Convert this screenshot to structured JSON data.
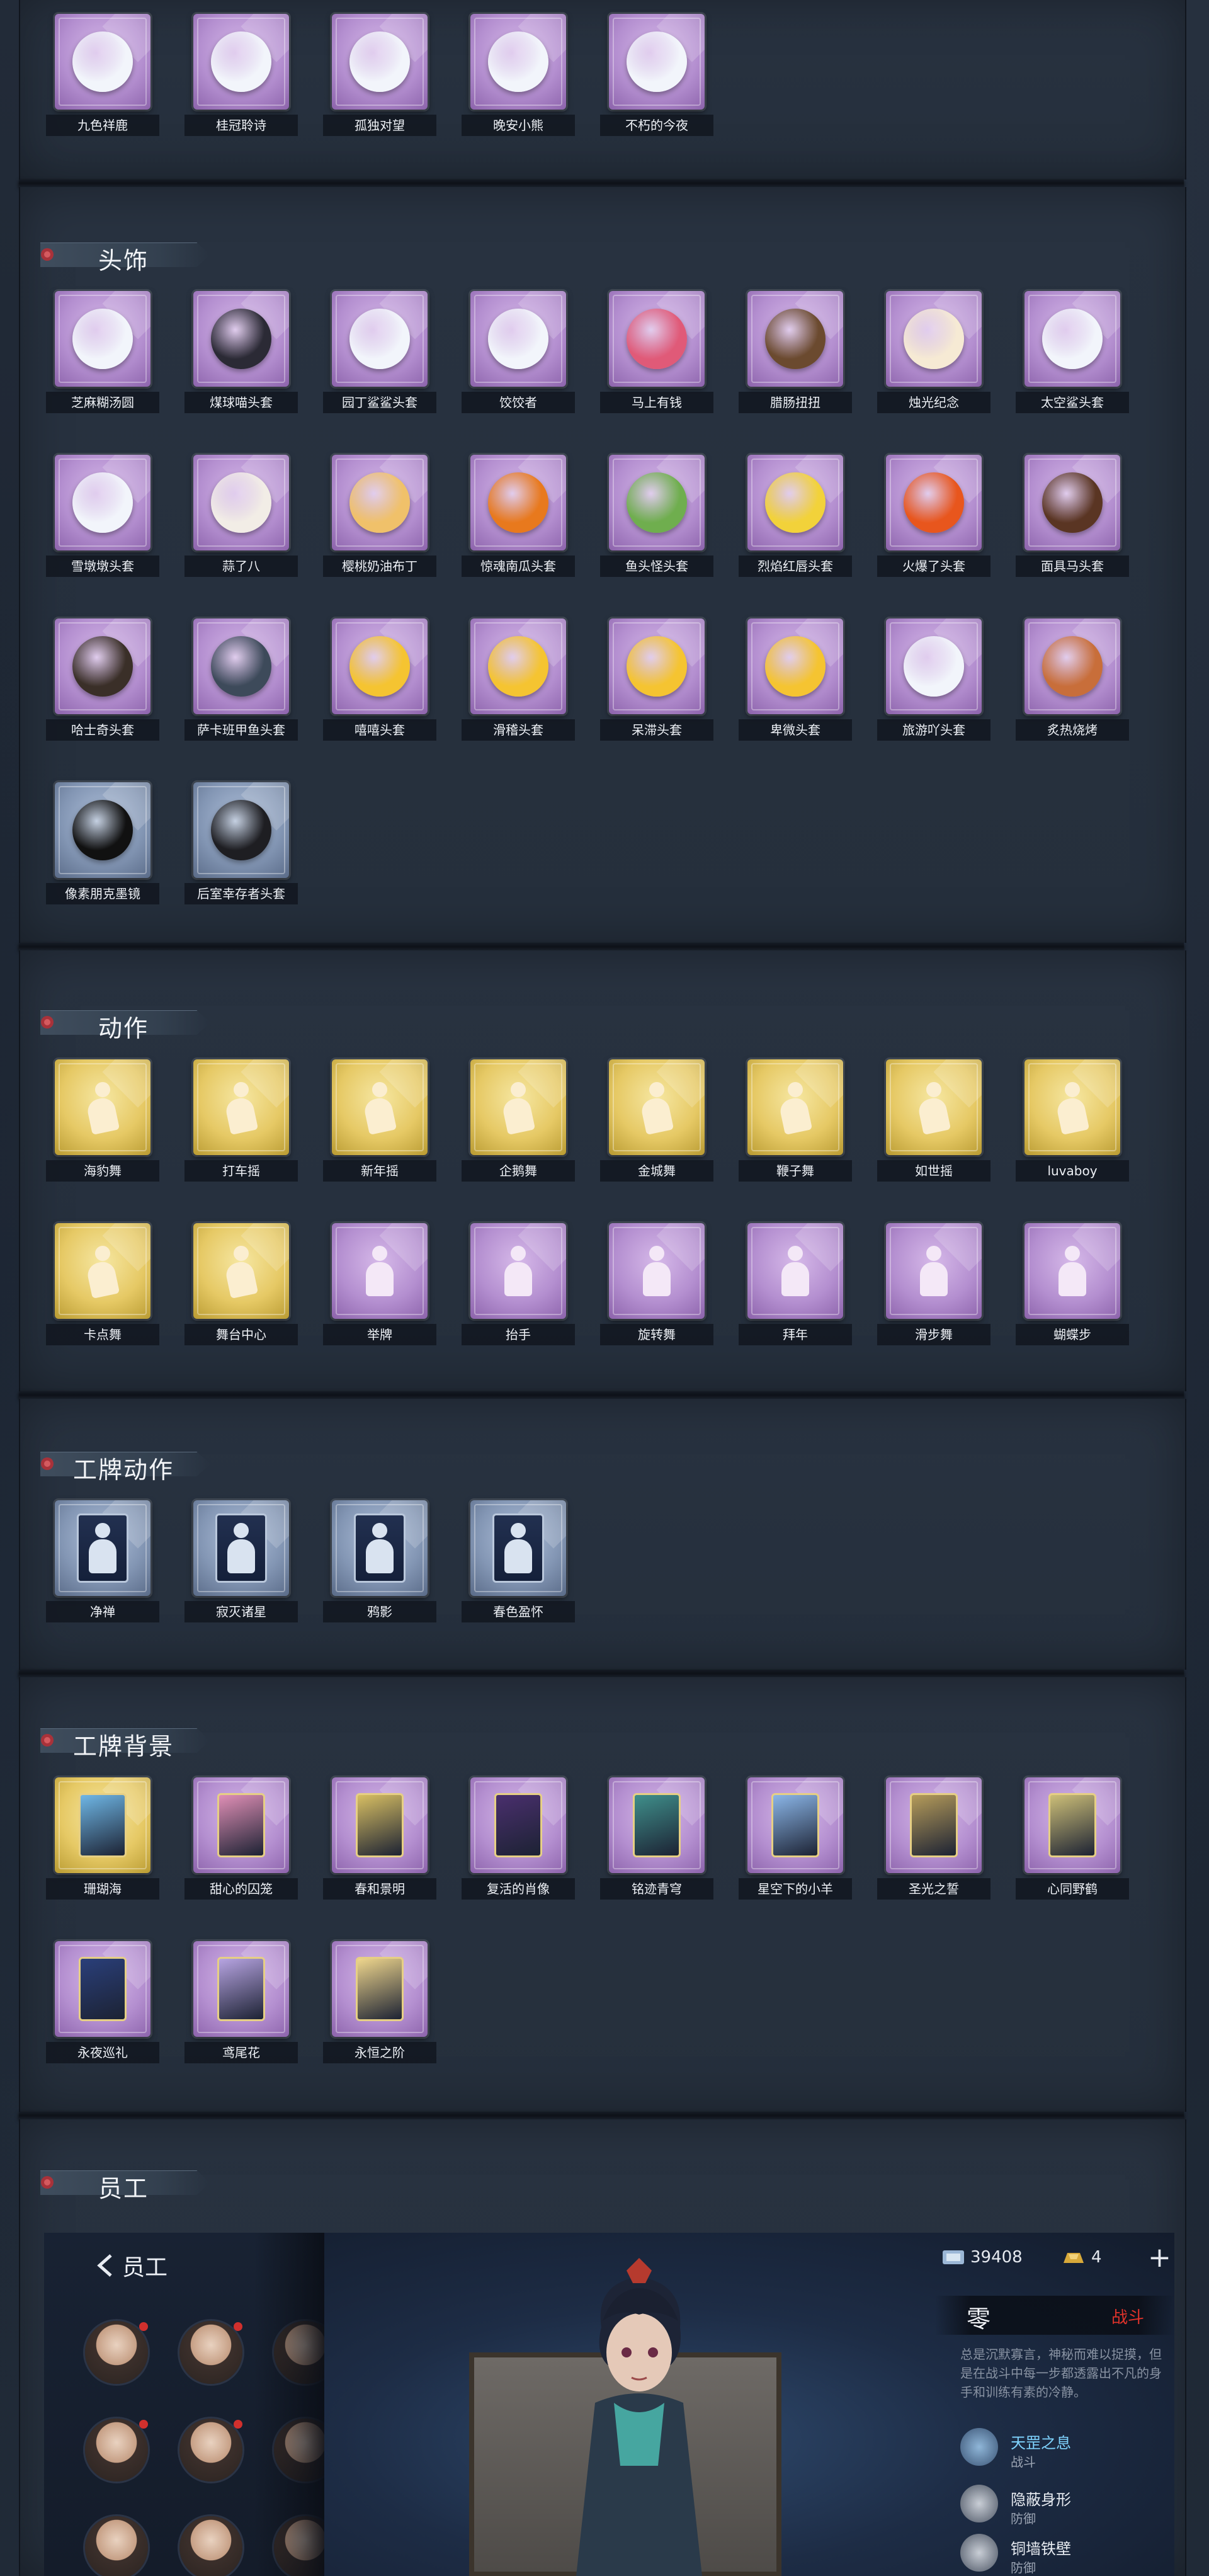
{
  "sections": {
    "top_row": {
      "items": [
        {
          "label": "九色祥鹿",
          "color": "purple",
          "icon": "deer-charm-icon"
        },
        {
          "label": "桂冠聆诗",
          "color": "purple",
          "icon": "laurel-charm-icon"
        },
        {
          "label": "孤独对望",
          "color": "purple",
          "icon": "doll-charm-icon"
        },
        {
          "label": "晚安小熊",
          "color": "purple",
          "icon": "bear-charm-icon"
        },
        {
          "label": "不朽的今夜",
          "color": "purple",
          "icon": "pink-charm-icon"
        }
      ]
    },
    "headwear": {
      "title": "头饰",
      "items": [
        {
          "label": "芝麻糊汤圆",
          "color": "purple",
          "icon": "dumpling-head-icon"
        },
        {
          "label": "煤球喵头套",
          "color": "purple",
          "icon": "black-cat-head-icon"
        },
        {
          "label": "园丁鲨鲨头套",
          "color": "purple",
          "icon": "shark-head-icon"
        },
        {
          "label": "饺饺者",
          "color": "purple",
          "icon": "cloud-head-icon"
        },
        {
          "label": "马上有钱",
          "color": "purple",
          "icon": "horse-head-icon"
        },
        {
          "label": "腊肠扭扭",
          "color": "purple",
          "icon": "dog-head-icon"
        },
        {
          "label": "烛光纪念",
          "color": "purple",
          "icon": "candle-head-icon"
        },
        {
          "label": "太空鲨头套",
          "color": "purple",
          "icon": "space-shark-head-icon"
        },
        {
          "label": "雪墩墩头套",
          "color": "purple",
          "icon": "snowman-head-icon"
        },
        {
          "label": "蒜了八",
          "color": "purple",
          "icon": "garlic-head-icon"
        },
        {
          "label": "樱桃奶油布丁",
          "color": "purple",
          "icon": "pudding-head-icon"
        },
        {
          "label": "惊魂南瓜头套",
          "color": "purple",
          "icon": "pumpkin-head-icon"
        },
        {
          "label": "鱼头怪头套",
          "color": "purple",
          "icon": "fish-monster-head-icon"
        },
        {
          "label": "烈焰红唇头套",
          "color": "purple",
          "icon": "yellow-creature-head-icon"
        },
        {
          "label": "火爆了头套",
          "color": "purple",
          "icon": "fireball-head-icon"
        },
        {
          "label": "面具马头套",
          "color": "purple",
          "icon": "brown-horse-head-icon"
        },
        {
          "label": "哈士奇头套",
          "color": "purple",
          "icon": "husky-head-icon"
        },
        {
          "label": "萨卡班甲鱼头套",
          "color": "purple",
          "icon": "fish-head-icon"
        },
        {
          "label": "嘻嘻头套",
          "color": "purple",
          "icon": "grin-emoji-head-icon"
        },
        {
          "label": "滑稽头套",
          "color": "purple",
          "icon": "smirk-emoji-head-icon"
        },
        {
          "label": "呆滞头套",
          "color": "purple",
          "icon": "dazed-emoji-head-icon"
        },
        {
          "label": "卑微头套",
          "color": "purple",
          "icon": "humble-emoji-head-icon"
        },
        {
          "label": "旅游吖头套",
          "color": "purple",
          "icon": "tourist-head-icon"
        },
        {
          "label": "炙热烧烤",
          "color": "purple",
          "icon": "barbecue-head-icon"
        },
        {
          "label": "像素朋克墨镜",
          "color": "blue",
          "icon": "pixel-sunglasses-icon"
        },
        {
          "label": "后室幸存者头套",
          "color": "blue",
          "icon": "gas-mask-helmet-icon"
        }
      ]
    },
    "actions": {
      "title": "动作",
      "items": [
        {
          "label": "海豹舞",
          "color": "gold",
          "icon": "dance-pose-icon"
        },
        {
          "label": "打车摇",
          "color": "gold",
          "icon": "dance-pose-icon"
        },
        {
          "label": "新年摇",
          "color": "gold",
          "icon": "dance-pose-icon"
        },
        {
          "label": "企鹅舞",
          "color": "gold",
          "icon": "dance-pose-icon"
        },
        {
          "label": "金城舞",
          "color": "gold",
          "icon": "dance-pose-icon"
        },
        {
          "label": "鞭子舞",
          "color": "gold",
          "icon": "dance-pose-icon"
        },
        {
          "label": "如世摇",
          "color": "gold",
          "icon": "dance-pose-icon"
        },
        {
          "label": "luvaboy",
          "color": "gold",
          "icon": "dance-pose-icon"
        },
        {
          "label": "卡点舞",
          "color": "gold",
          "icon": "dance-pose-icon"
        },
        {
          "label": "舞台中心",
          "color": "gold",
          "icon": "dance-pose-icon"
        },
        {
          "label": "举牌",
          "color": "purple",
          "icon": "sign-pose-icon"
        },
        {
          "label": "抬手",
          "color": "purple",
          "icon": "raise-hand-pose-icon"
        },
        {
          "label": "旋转舞",
          "color": "purple",
          "icon": "spin-pose-icon"
        },
        {
          "label": "拜年",
          "color": "purple",
          "icon": "greet-pose-icon"
        },
        {
          "label": "滑步舞",
          "color": "purple",
          "icon": "slide-pose-icon"
        },
        {
          "label": "蝴蝶步",
          "color": "purple",
          "icon": "butterfly-pose-icon"
        }
      ]
    },
    "badge_actions": {
      "title": "工牌动作",
      "items": [
        {
          "label": "净禅",
          "color": "blue",
          "icon": "badge-pose-icon"
        },
        {
          "label": "寂灭诸星",
          "color": "blue",
          "icon": "badge-pose-icon"
        },
        {
          "label": "鸦影",
          "color": "blue",
          "icon": "badge-pose-icon"
        },
        {
          "label": "春色盈怀",
          "color": "blue",
          "icon": "badge-pose-icon"
        }
      ]
    },
    "badge_backgrounds": {
      "title": "工牌背景",
      "items": [
        {
          "label": "珊瑚海",
          "color": "gold",
          "icon": "card-background-icon",
          "tint": "#6fb7e6"
        },
        {
          "label": "甜心的囚笼",
          "color": "purple",
          "icon": "card-background-icon",
          "tint": "#e08fb6"
        },
        {
          "label": "春和景明",
          "color": "purple",
          "icon": "card-background-icon",
          "tint": "#d8bf63"
        },
        {
          "label": "复活的肖像",
          "color": "purple",
          "icon": "card-background-icon",
          "tint": "#4a2f6e"
        },
        {
          "label": "铭迹青穹",
          "color": "purple",
          "icon": "card-background-icon",
          "tint": "#3f8f8b"
        },
        {
          "label": "星空下的小羊",
          "color": "purple",
          "icon": "card-background-icon",
          "tint": "#8bb6e8"
        },
        {
          "label": "圣光之誓",
          "color": "purple",
          "icon": "card-background-icon",
          "tint": "#b59b5a"
        },
        {
          "label": "心同野鹤",
          "color": "purple",
          "icon": "card-background-icon",
          "tint": "#cdbf78"
        },
        {
          "label": "永夜巡礼",
          "color": "purple",
          "icon": "card-background-icon",
          "tint": "#2a3f7a"
        },
        {
          "label": "鸢尾花",
          "color": "purple",
          "icon": "card-background-icon",
          "tint": "#b7a4e2"
        },
        {
          "label": "永恒之阶",
          "color": "purple",
          "icon": "card-background-icon",
          "tint": "#efd68d"
        }
      ]
    },
    "staff": {
      "title": "员工"
    }
  },
  "game_ui": {
    "back_label": "员工",
    "currency_1": "39408",
    "currency_2": "4",
    "plus_label": "+",
    "character_name": "零",
    "character_tag": "战斗",
    "description": "总是沉默寡言，神秘而难以捉摸，但是在战斗中每一步都透露出不凡的身手和训练有素的冷静。",
    "skills": [
      {
        "name": "天罡之息",
        "type": "战斗",
        "icon": "skill-breath-icon"
      },
      {
        "name": "隐蔽身形",
        "type": "防御",
        "icon": "skill-stealth-icon"
      },
      {
        "name": "铜墙铁壁",
        "type": "防御",
        "icon": "skill-wall-icon"
      }
    ],
    "colors": {
      "accent": "#e2332b",
      "skill_name": "#7fd4ff"
    }
  }
}
